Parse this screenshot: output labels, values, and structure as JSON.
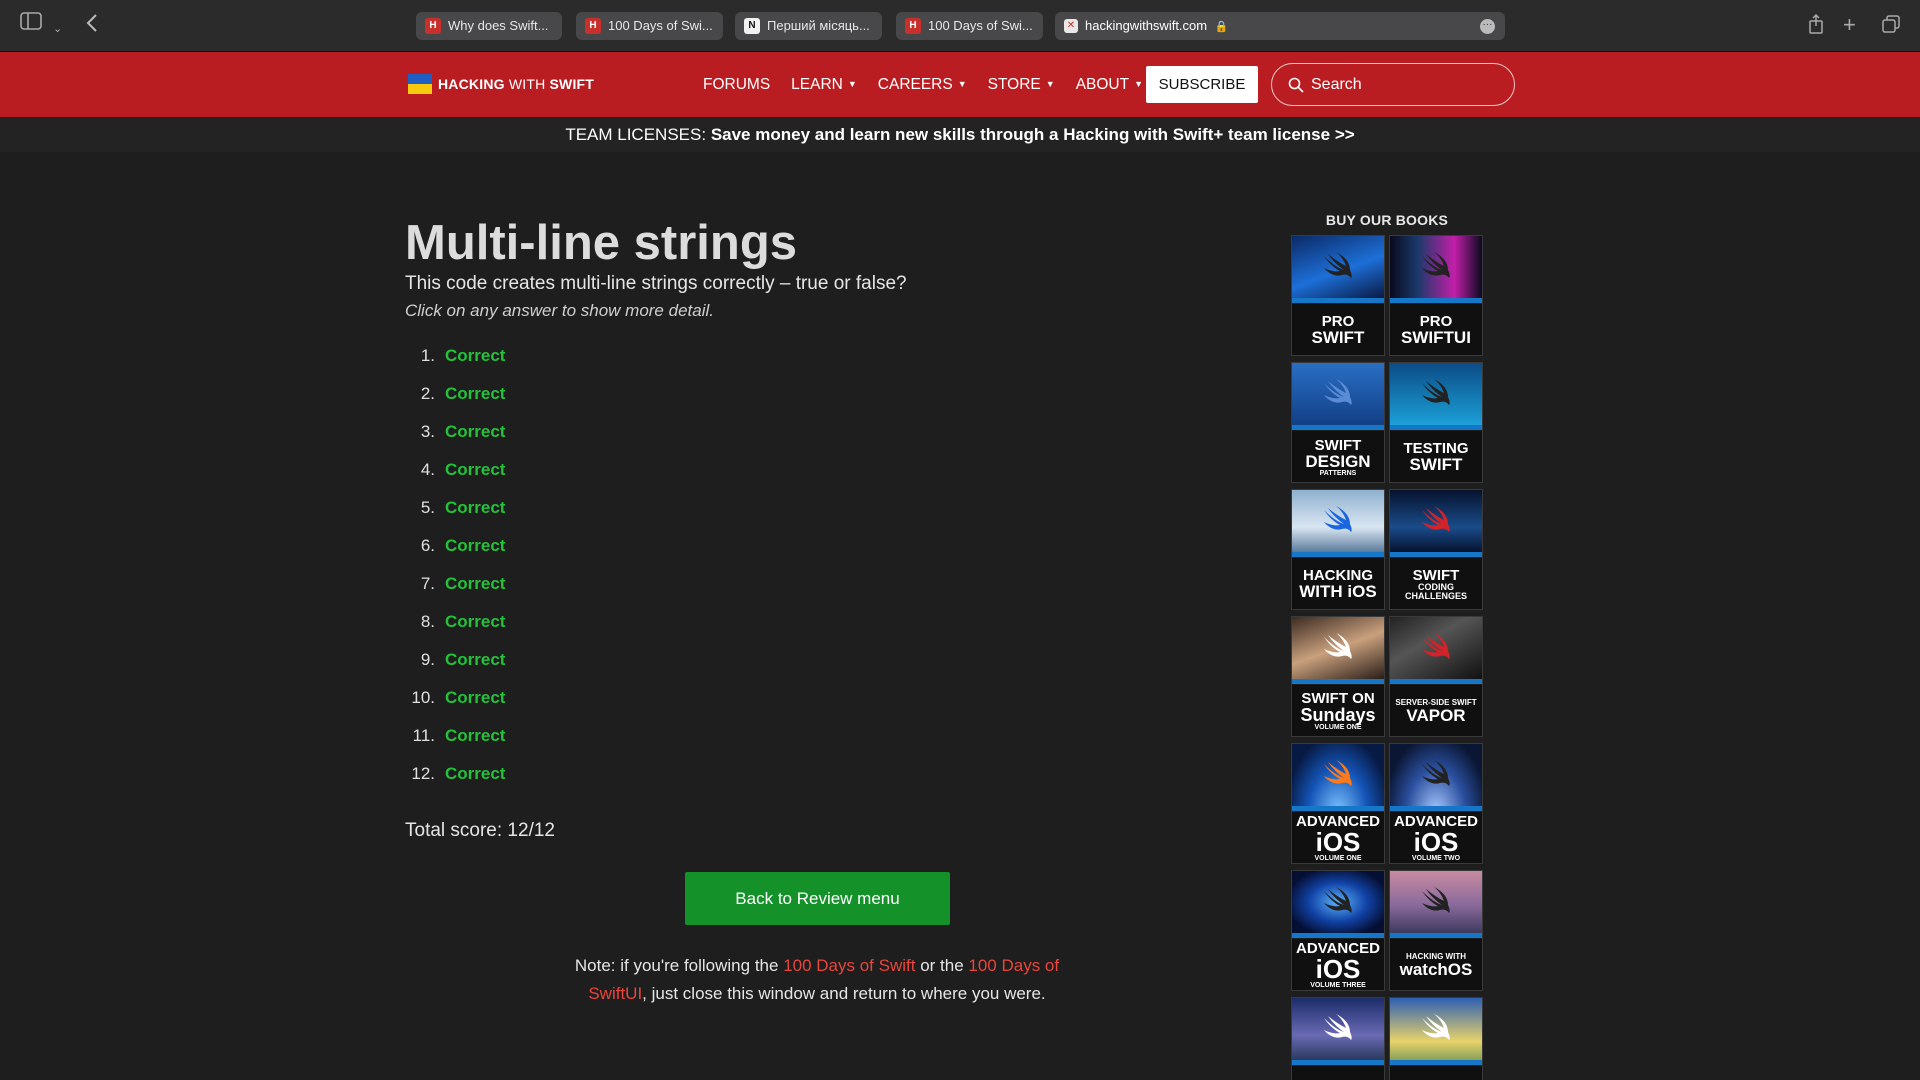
{
  "browser": {
    "tabs": [
      {
        "title": "Why does Swift...",
        "favicon": "hws-icon"
      },
      {
        "title": "100 Days of Swi...",
        "favicon": "hws-icon"
      },
      {
        "title": "Перший місяць...",
        "favicon": "notion-icon"
      },
      {
        "title": "100 Days of Swi...",
        "favicon": "hws-icon"
      }
    ],
    "url": "hackingwithswift.com"
  },
  "nav": {
    "logo_bold": "HACKING",
    "logo_thin": "WITH",
    "logo_bold2": "SWIFT",
    "items": [
      "FORUMS",
      "LEARN",
      "CAREERS",
      "STORE",
      "ABOUT"
    ],
    "subscribe_label": "SUBSCRIBE",
    "search_placeholder": "Search"
  },
  "banner": {
    "prefix": "TEAM LICENSES:",
    "text": "Save money and learn new skills through a Hacking with Swift+ team license",
    "suffix": ">>"
  },
  "main": {
    "title": "Multi-line strings",
    "question": "This code creates multi-line strings correctly – true or false?",
    "hint": "Click on any answer to show more detail.",
    "answers": [
      {
        "num": "1.",
        "result": "Correct"
      },
      {
        "num": "2.",
        "result": "Correct"
      },
      {
        "num": "3.",
        "result": "Correct"
      },
      {
        "num": "4.",
        "result": "Correct"
      },
      {
        "num": "5.",
        "result": "Correct"
      },
      {
        "num": "6.",
        "result": "Correct"
      },
      {
        "num": "7.",
        "result": "Correct"
      },
      {
        "num": "8.",
        "result": "Correct"
      },
      {
        "num": "9.",
        "result": "Correct"
      },
      {
        "num": "10.",
        "result": "Correct"
      },
      {
        "num": "11.",
        "result": "Correct"
      },
      {
        "num": "12.",
        "result": "Correct"
      }
    ],
    "score": "Total score: 12/12",
    "back_label": "Back to Review menu",
    "note_1": "Note: if you're following the ",
    "note_link_1": "100 Days of Swift",
    "note_2": " or the ",
    "note_link_2": "100 Days of SwiftUI",
    "note_3": ", just close this window and return to where you were."
  },
  "books": {
    "title": "BUY OUR BOOKS",
    "items": [
      {
        "line1": "PRO",
        "line2": "SWIFT",
        "line3": ""
      },
      {
        "line1": "PRO",
        "line2": "SWIFTUI",
        "line3": ""
      },
      {
        "line1": "SWIFT",
        "line2": "DESIGN",
        "line3": "PATTERNS"
      },
      {
        "line1": "TESTING",
        "line2": "SWIFT",
        "line3": ""
      },
      {
        "line1": "HACKING",
        "line2": "WITH iOS",
        "line3": ""
      },
      {
        "line1": "SWIFT",
        "line2": "CODING CHALLENGES",
        "line3": ""
      },
      {
        "line1": "SWIFT ON",
        "line2": "Sundays",
        "line3": "VOLUME ONE"
      },
      {
        "line1": "SERVER-SIDE SWIFT",
        "line2": "VAPOR",
        "line3": ""
      },
      {
        "line1": "ADVANCED",
        "line2": "iOS",
        "line3": "VOLUME ONE"
      },
      {
        "line1": "ADVANCED",
        "line2": "iOS",
        "line3": "VOLUME TWO"
      },
      {
        "line1": "ADVANCED",
        "line2": "iOS",
        "line3": "VOLUME THREE"
      },
      {
        "line1": "HACKING WITH",
        "line2": "watchOS",
        "line3": ""
      },
      {
        "line1": "",
        "line2": "",
        "line3": ""
      },
      {
        "line1": "",
        "line2": "",
        "line3": ""
      }
    ]
  },
  "colors": {
    "brand_red": "#b91d21",
    "correct_green": "#25c13b",
    "button_green": "#149229",
    "link_red": "#e8453c"
  }
}
